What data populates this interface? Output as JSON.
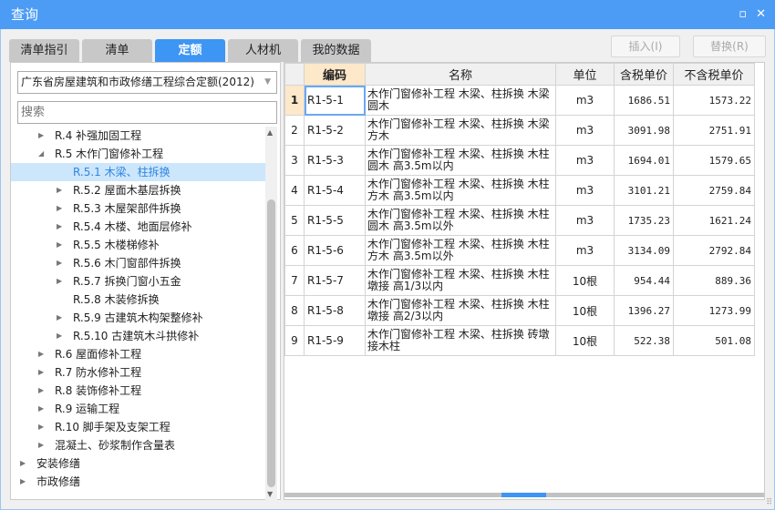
{
  "window": {
    "title": "查询",
    "minimize_icon": "minimize-icon",
    "close_icon": "close-icon"
  },
  "tabs": [
    {
      "label": "清单指引"
    },
    {
      "label": "清单"
    },
    {
      "label": "定额",
      "active": true
    },
    {
      "label": "人材机"
    },
    {
      "label": "我的数据"
    }
  ],
  "toolbar": {
    "insert_label": "插入(I)",
    "replace_label": "替换(R)"
  },
  "left": {
    "quota_select": "广东省房屋建筑和市政修缮工程综合定额(2012)",
    "search_placeholder": "搜索",
    "tree": [
      {
        "label": "R.4 补强加固工程",
        "level": 1,
        "state": "collapsed"
      },
      {
        "label": "R.5 木作门窗修补工程",
        "level": 1,
        "state": "expanded"
      },
      {
        "label": "R.5.1 木梁、柱拆换",
        "level": 2,
        "state": "leaf",
        "selected": true
      },
      {
        "label": "R.5.2 屋面木基层拆换",
        "level": 2,
        "state": "collapsed"
      },
      {
        "label": "R.5.3 木屋架部件拆换",
        "level": 2,
        "state": "collapsed"
      },
      {
        "label": "R.5.4 木楼、地面层修补",
        "level": 2,
        "state": "collapsed"
      },
      {
        "label": "R.5.5 木楼梯修补",
        "level": 2,
        "state": "collapsed"
      },
      {
        "label": "R.5.6 木门窗部件拆换",
        "level": 2,
        "state": "collapsed"
      },
      {
        "label": "R.5.7 拆换门窗小五金",
        "level": 2,
        "state": "collapsed"
      },
      {
        "label": "R.5.8 木装修拆换",
        "level": 2,
        "state": "leaf"
      },
      {
        "label": "R.5.9 古建筑木构架整修补",
        "level": 2,
        "state": "collapsed"
      },
      {
        "label": "R.5.10 古建筑木斗拱修补",
        "level": 2,
        "state": "collapsed"
      },
      {
        "label": "R.6 屋面修补工程",
        "level": 1,
        "state": "collapsed"
      },
      {
        "label": "R.7 防水修补工程",
        "level": 1,
        "state": "collapsed"
      },
      {
        "label": "R.8 装饰修补工程",
        "level": 1,
        "state": "collapsed"
      },
      {
        "label": "R.9 运输工程",
        "level": 1,
        "state": "collapsed"
      },
      {
        "label": "R.10 脚手架及支架工程",
        "level": 1,
        "state": "collapsed"
      },
      {
        "label": "混凝土、砂浆制作含量表",
        "level": 1,
        "state": "collapsed"
      },
      {
        "label": "安装修缮",
        "level": 0,
        "state": "collapsed"
      },
      {
        "label": "市政修缮",
        "level": 0,
        "state": "collapsed"
      }
    ]
  },
  "table": {
    "columns": [
      "",
      "编码",
      "名称",
      "单位",
      "含税单价",
      "不含税单价"
    ],
    "rows": [
      [
        "1",
        "R1-5-1",
        "木作门窗修补工程 木梁、柱拆换 木梁圆木",
        "m3",
        "1686.51",
        "1573.22"
      ],
      [
        "2",
        "R1-5-2",
        "木作门窗修补工程 木梁、柱拆换 木梁方木",
        "m3",
        "3091.98",
        "2751.91"
      ],
      [
        "3",
        "R1-5-3",
        "木作门窗修补工程 木梁、柱拆换 木柱圆木 高3.5m以内",
        "m3",
        "1694.01",
        "1579.65"
      ],
      [
        "4",
        "R1-5-4",
        "木作门窗修补工程 木梁、柱拆换 木柱方木 高3.5m以内",
        "m3",
        "3101.21",
        "2759.84"
      ],
      [
        "5",
        "R1-5-5",
        "木作门窗修补工程 木梁、柱拆换 木柱圆木 高3.5m以外",
        "m3",
        "1735.23",
        "1621.24"
      ],
      [
        "6",
        "R1-5-6",
        "木作门窗修补工程 木梁、柱拆换 木柱方木 高3.5m以外",
        "m3",
        "3134.09",
        "2792.84"
      ],
      [
        "7",
        "R1-5-7",
        "木作门窗修补工程 木梁、柱拆换 木柱墩接 高1/3以内",
        "10根",
        "954.44",
        "889.36"
      ],
      [
        "8",
        "R1-5-8",
        "木作门窗修补工程 木梁、柱拆换 木柱墩接 高2/3以内",
        "10根",
        "1396.27",
        "1273.99"
      ],
      [
        "9",
        "R1-5-9",
        "木作门窗修补工程 木梁、柱拆换 砖墩接木柱",
        "10根",
        "522.38",
        "501.08"
      ]
    ]
  },
  "colors": {
    "accent": "#3d95f4",
    "titlebar": "#4c9cf6",
    "header_highlight": "#fde8c9",
    "selection": "#cce6fb"
  }
}
